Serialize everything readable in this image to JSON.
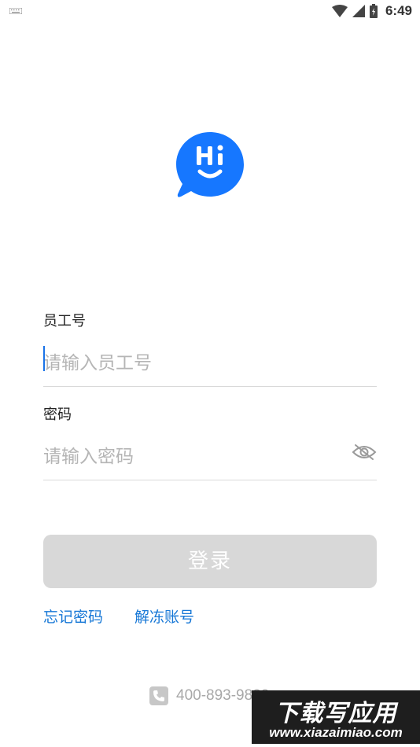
{
  "status_bar": {
    "time": "6:49",
    "icons": [
      "keyboard-icon",
      "wifi-icon",
      "signal-icon",
      "battery-icon"
    ]
  },
  "logo": {
    "text": "Hi",
    "icon": "chat-bubble-logo-icon",
    "color": "#1677ff"
  },
  "form": {
    "employee_id": {
      "label": "员工号",
      "placeholder": "请输入员工号",
      "value": ""
    },
    "password": {
      "label": "密码",
      "placeholder": "请输入密码",
      "value": "",
      "toggle_icon": "eye-off-icon"
    }
  },
  "login_button": {
    "label": "登录",
    "background": "#d8d8d8"
  },
  "links": {
    "forgot_password": "忘记密码",
    "unfreeze_account": "解冻账号",
    "color": "#1677d6"
  },
  "support": {
    "phone": "400-893-9888",
    "icon": "phone-icon"
  },
  "watermark": {
    "title": "下载写应用",
    "url": "www.xiazaimiao.com"
  }
}
